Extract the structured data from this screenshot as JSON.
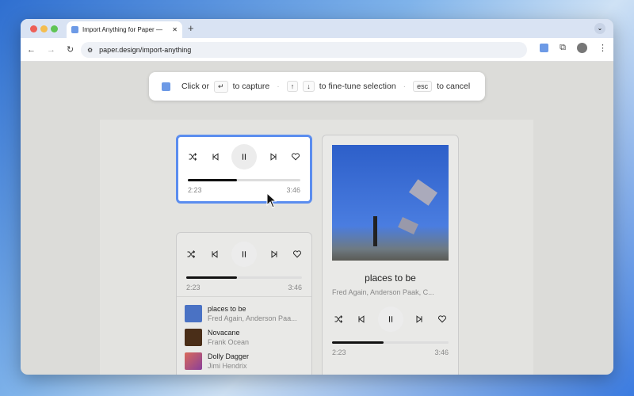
{
  "browser": {
    "tab_title": "Import Anything for Paper — ",
    "url": "paper.design/import-anything"
  },
  "hint": {
    "click_or": "Click or",
    "enter_key": "↵",
    "to_capture": "to capture",
    "up_key": "↑",
    "down_key": "↓",
    "fine_tune": "to fine-tune selection",
    "esc_key": "esc",
    "to_cancel": "to cancel",
    "separator": "·"
  },
  "player": {
    "elapsed": "2:23",
    "duration": "3:46",
    "progress": 0.44
  },
  "now_playing": {
    "title": "places to be",
    "artist": "Fred Again, Anderson Paak, C..."
  },
  "queue": [
    {
      "title": "places to be",
      "artist": "Fred Again, Anderson Paa...",
      "color": "#4a72c4"
    },
    {
      "title": "Novacane",
      "artist": "Frank Ocean",
      "color": "#4a2e18"
    },
    {
      "title": "Dolly Dagger",
      "artist": "Jimi Hendrix",
      "color": "#c4506a"
    }
  ],
  "colors": {
    "selection": "#5b8def"
  }
}
